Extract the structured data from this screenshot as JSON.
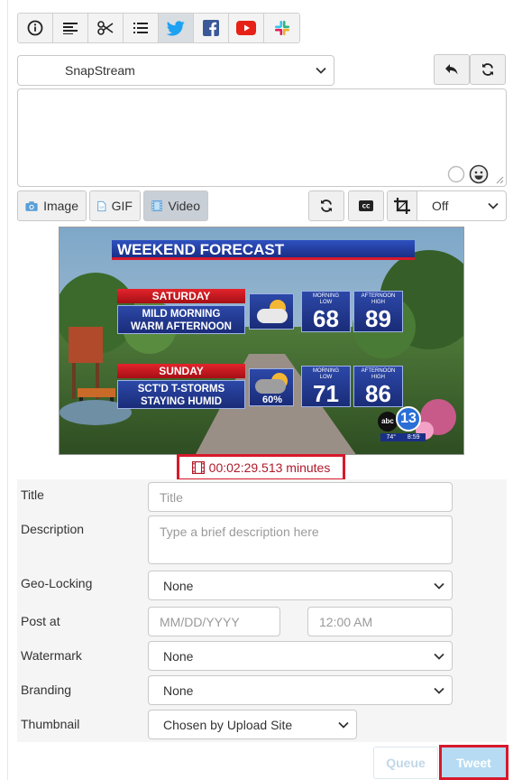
{
  "toolbar": {
    "tabs": [
      {
        "name": "info",
        "icon": "info-icon"
      },
      {
        "name": "text",
        "icon": "align-left-icon"
      },
      {
        "name": "clip",
        "icon": "scissors-icon"
      },
      {
        "name": "list",
        "icon": "list-icon"
      },
      {
        "name": "twitter",
        "icon": "twitter-icon",
        "active": true
      },
      {
        "name": "facebook",
        "icon": "facebook-icon"
      },
      {
        "name": "youtube",
        "icon": "youtube-icon"
      },
      {
        "name": "slack",
        "icon": "slack-icon"
      }
    ]
  },
  "account": {
    "selected": "SnapStream"
  },
  "media": {
    "image_label": "Image",
    "gif_label": "GIF",
    "video_label": "Video",
    "crop_select": "Off"
  },
  "video_frame": {
    "header": "WEEKEND FORECAST",
    "days": [
      {
        "day": "SATURDAY",
        "line1": "MILD MORNING",
        "line2": "WARM AFTERNOON",
        "low_label1": "MORNING",
        "low_label2": "LOW",
        "low": "68",
        "high_label1": "AFTERNOON",
        "high_label2": "HIGH",
        "high": "89",
        "pct": ""
      },
      {
        "day": "SUNDAY",
        "line1": "SCT'D T-STORMS",
        "line2": "STAYING HUMID",
        "low_label1": "MORNING",
        "low_label2": "LOW",
        "low": "71",
        "high_label1": "AFTERNOON",
        "high_label2": "HIGH",
        "high": "86",
        "pct": "60%"
      }
    ],
    "station_logo": "abc",
    "channel": "13",
    "temp": "74°",
    "time": "8:59"
  },
  "duration": "00:02:29.513 minutes",
  "form": {
    "title_label": "Title",
    "title_placeholder": "Title",
    "description_label": "Description",
    "description_placeholder": "Type a brief description here",
    "geolocking_label": "Geo-Locking",
    "geolocking_value": "None",
    "postat_label": "Post at",
    "date_placeholder": "MM/DD/YYYY",
    "time_placeholder": "12:00 AM",
    "watermark_label": "Watermark",
    "watermark_value": "None",
    "branding_label": "Branding",
    "branding_value": "None",
    "thumbnail_label": "Thumbnail",
    "thumbnail_value": "Chosen by Upload Site"
  },
  "actions": {
    "queue_label": "Queue",
    "tweet_label": "Tweet"
  },
  "colors": {
    "twitter": "#1da1f2",
    "facebook": "#3b5998",
    "youtube": "#e62117",
    "highlight": "#d7192b",
    "duration_text": "#b0192a"
  }
}
